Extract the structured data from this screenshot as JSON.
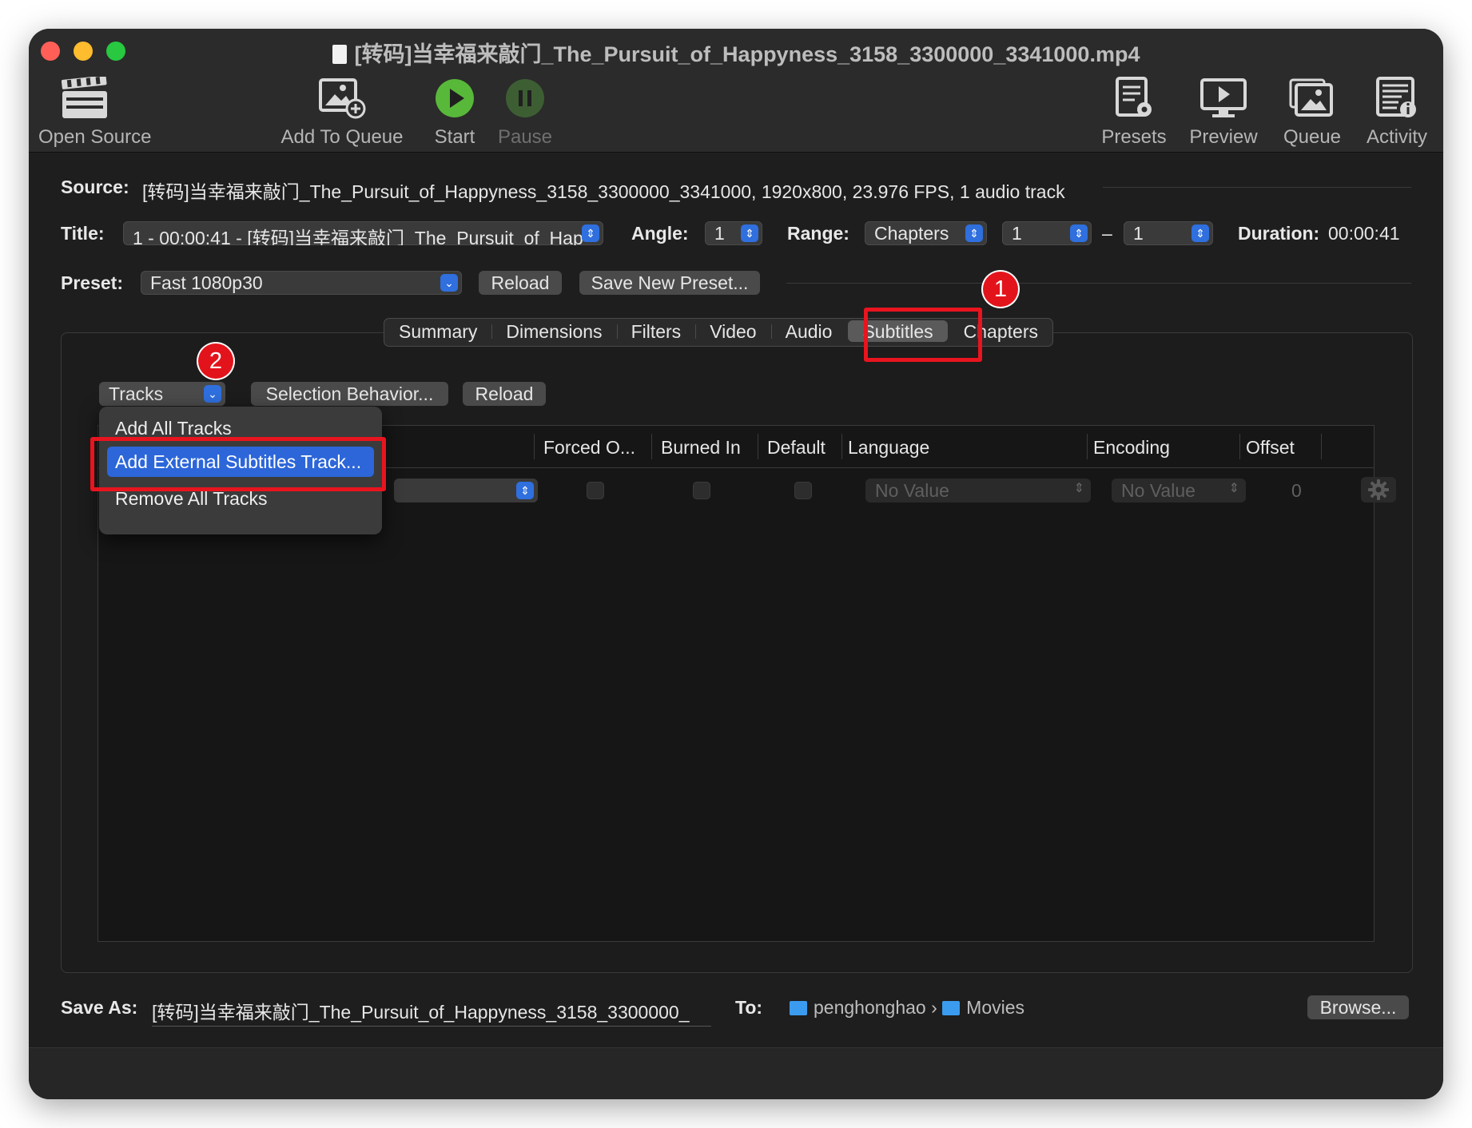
{
  "window": {
    "title": "[转码]当幸福来敲门_The_Pursuit_of_Happyness_3158_3300000_3341000.mp4"
  },
  "toolbar": {
    "open_source": "Open Source",
    "add_to_queue": "Add To Queue",
    "start": "Start",
    "pause": "Pause",
    "presets": "Presets",
    "preview": "Preview",
    "queue": "Queue",
    "activity": "Activity"
  },
  "source": {
    "label": "Source:",
    "value": "[转码]当幸福来敲门_The_Pursuit_of_Happyness_3158_3300000_3341000, 1920x800, 23.976 FPS, 1 audio track"
  },
  "title_row": {
    "title_label": "Title:",
    "title_value": "1 - 00:00:41 - [转码]当幸福来敲门_The_Pursuit_of_Hap",
    "angle_label": "Angle:",
    "angle_value": "1",
    "range_label": "Range:",
    "range_value": "Chapters",
    "range_start": "1",
    "range_dash": "–",
    "range_end": "1",
    "duration_label": "Duration:",
    "duration_value": "00:00:41"
  },
  "preset_row": {
    "preset_label": "Preset:",
    "preset_value": "Fast 1080p30",
    "reload": "Reload",
    "save_new_preset": "Save New Preset..."
  },
  "tabs": [
    "Summary",
    "Dimensions",
    "Filters",
    "Video",
    "Audio",
    "Subtitles",
    "Chapters"
  ],
  "active_tab": "Subtitles",
  "subtitles": {
    "tracks_button": "Tracks",
    "selection_behavior": "Selection Behavior...",
    "reload": "Reload",
    "columns": {
      "forced": "Forced O...",
      "burned": "Burned In",
      "default": "Default",
      "language": "Language",
      "encoding": "Encoding",
      "offset": "Offset"
    },
    "row": {
      "language": "No Value",
      "encoding": "No Value",
      "offset": "0"
    }
  },
  "tracks_menu": {
    "add_all": "Add All Tracks",
    "add_external": "Add External Subtitles Track...",
    "remove_all": "Remove All Tracks"
  },
  "annotations": {
    "step1": "1",
    "step2": "2",
    "highlight_color": "#e8141e"
  },
  "save_row": {
    "save_as_label": "Save As:",
    "save_as_value": "[转码]当幸福来敲门_The_Pursuit_of_Happyness_3158_3300000_",
    "to_label": "To:",
    "path_user": "penghonghao",
    "path_sep": "›",
    "path_folder": "Movies",
    "browse": "Browse..."
  }
}
